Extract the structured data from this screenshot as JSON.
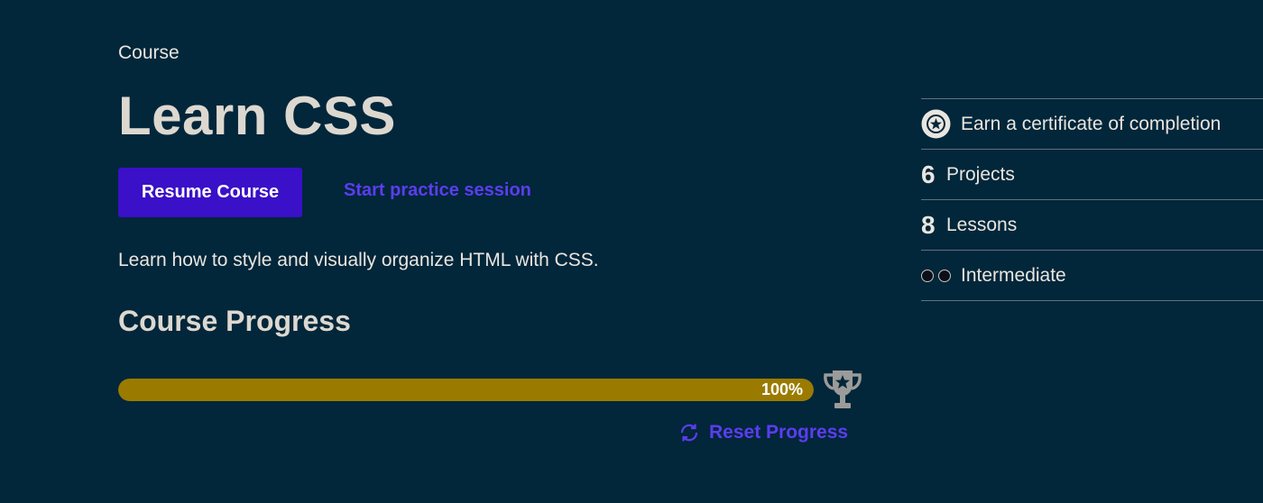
{
  "header": {
    "eyebrow": "Course",
    "title": "Learn CSS"
  },
  "actions": {
    "resume_label": "Resume Course",
    "practice_label": "Start practice session"
  },
  "description": "Learn how to style and visually organize HTML with CSS.",
  "progress": {
    "heading": "Course Progress",
    "percent": 100,
    "percent_label": "100%",
    "reset_label": "Reset Progress",
    "bar_color": "#9a7b00",
    "trophy_icon": "trophy-icon",
    "reset_icon": "refresh-icon"
  },
  "sidebar": {
    "certificate": {
      "icon": "certificate-star-icon",
      "label": "Earn a certificate of completion"
    },
    "projects": {
      "count": "6",
      "label": "Projects"
    },
    "lessons": {
      "count": "8",
      "label": "Lessons"
    },
    "difficulty": {
      "icon": "difficulty-dots-icon",
      "label": "Intermediate"
    }
  },
  "colors": {
    "background": "#02263a",
    "accent": "#3a10c8",
    "link": "#5b3df0",
    "text": "#e9e6df"
  }
}
